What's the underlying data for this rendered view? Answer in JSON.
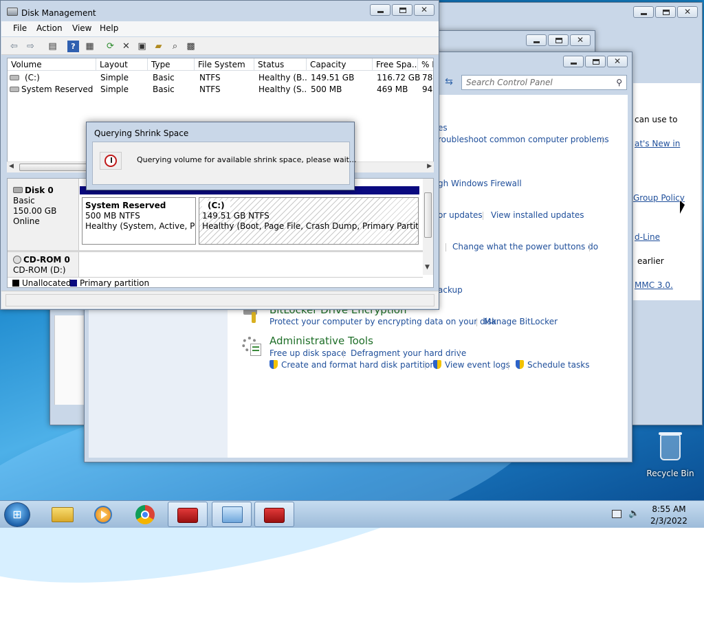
{
  "disk_management": {
    "title": "Disk Management",
    "menu": [
      "File",
      "Action",
      "View",
      "Help"
    ],
    "columns": [
      "Volume",
      "Layout",
      "Type",
      "File System",
      "Status",
      "Capacity",
      "Free Spa...",
      "% F"
    ],
    "volumes": [
      {
        "volume": "(C:)",
        "layout": "Simple",
        "type": "Basic",
        "fs": "NTFS",
        "status": "Healthy (B...",
        "capacity": "149.51 GB",
        "free": "116.72 GB",
        "pct": "78"
      },
      {
        "volume": "System Reserved",
        "layout": "Simple",
        "type": "Basic",
        "fs": "NTFS",
        "status": "Healthy (S...",
        "capacity": "500 MB",
        "free": "469 MB",
        "pct": "94"
      }
    ],
    "disk0": {
      "name": "Disk 0",
      "type": "Basic",
      "size": "150.00 GB",
      "state": "Online"
    },
    "partitions": [
      {
        "name": "System Reserved",
        "size": "500 MB NTFS",
        "status": "Healthy (System, Active, Primary Partition)"
      },
      {
        "name": "(C:)",
        "size": "149.51 GB NTFS",
        "status": "Healthy (Boot, Page File, Crash Dump, Primary Partition)"
      }
    ],
    "cdrom": {
      "name": "CD-ROM 0",
      "drive": "CD-ROM (D:)"
    },
    "legend": [
      "Unallocated",
      "Primary partition"
    ]
  },
  "dialog": {
    "title": "Querying Shrink Space",
    "message": "Querying volume for available shrink space, please wait..."
  },
  "control_panel": {
    "search_placeholder": "Search Control Panel",
    "links": {
      "es": "es",
      "troubleshoot": "roubleshoot common computer problems",
      "firewall": "gh Windows Firewall",
      "updates": "or updates",
      "installed_updates": "View installed updates",
      "power_buttons": "Change what the power buttons do",
      "backup": "ackup",
      "bitlocker_header": "BitLocker Drive Encryption",
      "bitlocker_protect": "Protect your computer by encrypting data on your disk",
      "bitlocker_manage": "Manage BitLocker",
      "admin_header": "Administrative Tools",
      "free_up": "Free up disk space",
      "defrag": "Defragment your hard drive",
      "format": "Create and format hard disk partitions",
      "event_logs": "View event logs",
      "schedule": "Schedule tasks"
    }
  },
  "back_window": {
    "lines": [
      "can use to",
      "at's New in",
      "Group Policy",
      "d-Line",
      "earlier",
      "MMC 3.0."
    ]
  },
  "desktop": {
    "recycle_bin": "Recycle Bin"
  },
  "taskbar": {
    "time": "8:55 AM",
    "date": "2/3/2022"
  }
}
